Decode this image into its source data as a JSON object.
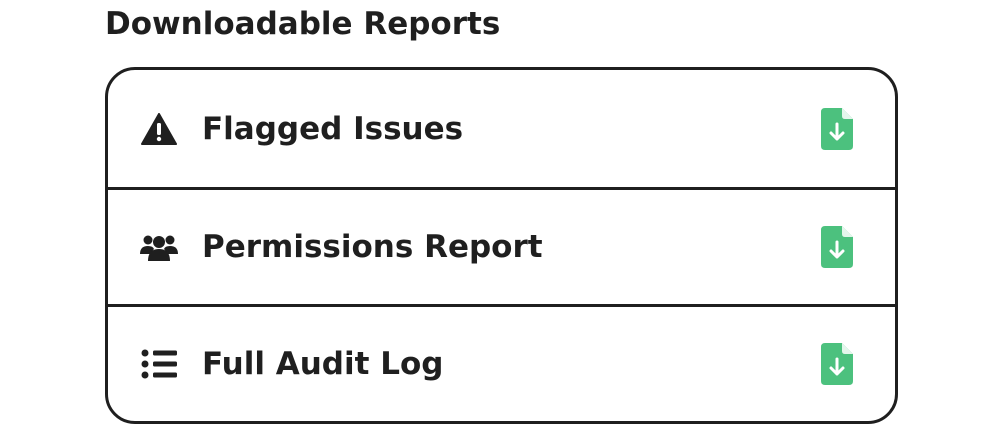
{
  "section": {
    "title": "Downloadable Reports"
  },
  "reports": [
    {
      "label": "Flagged Issues",
      "icon": "warning-icon",
      "action_icon": "file-download-icon"
    },
    {
      "label": "Permissions Report",
      "icon": "users-icon",
      "action_icon": "file-download-icon"
    },
    {
      "label": "Full Audit Log",
      "icon": "list-icon",
      "action_icon": "file-download-icon"
    }
  ],
  "colors": {
    "text": "#1f1f1f",
    "border": "#1f1f1f",
    "download_accent": "#4cc17e",
    "background": "#ffffff"
  }
}
